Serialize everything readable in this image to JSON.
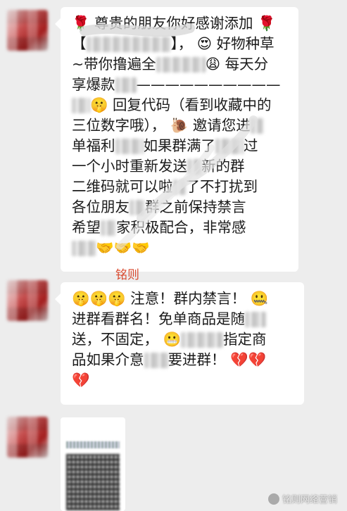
{
  "messages": [
    {
      "lines": [
        [
          "🌹 尊贵的朋友你好感谢添加 🌹"
        ],
        [
          "【",
          "",
          "】， 😍 好物种草"
        ],
        [
          "~带你撸遍全",
          "",
          "😩 每天分"
        ],
        [
          "享爆款",
          "",
          "——————————"
        ],
        [
          "",
          "🤫 回复代码（看到收藏中的"
        ],
        [
          "三位数字哦）， 🐌 邀请您进",
          ""
        ],
        [
          "单福利",
          "",
          "如果群满了",
          "",
          "过"
        ],
        [
          "一个小时重新发送",
          "",
          "新的群"
        ],
        [
          "二维码就可以啦",
          "",
          "了不打扰到"
        ],
        [
          "各位朋友",
          "",
          "群之前保持禁言"
        ],
        [
          "希望",
          "",
          "家积极配合，非常感"
        ],
        [
          "",
          "🤝🤝🤝"
        ]
      ]
    },
    {
      "sender": "铭则",
      "lines": [
        [
          "🤫🤫🤫 注意！群内禁言！ 🤐"
        ],
        [
          "进群看群名！免单商品是随",
          "",
          ""
        ],
        [
          "送，不固定， 😬",
          "",
          "指定商"
        ],
        [
          "品如果介意",
          "",
          "要进群！ 💔💔"
        ],
        [
          "💔"
        ]
      ]
    }
  ],
  "watermark": "铭则网络营销",
  "icons": [
    "rose-icon",
    "heart-eyes-icon",
    "weary-icon",
    "shush-icon",
    "snail-icon",
    "handshake-icon",
    "zipper-mouth-icon",
    "grimace-icon",
    "broken-heart-icon"
  ]
}
